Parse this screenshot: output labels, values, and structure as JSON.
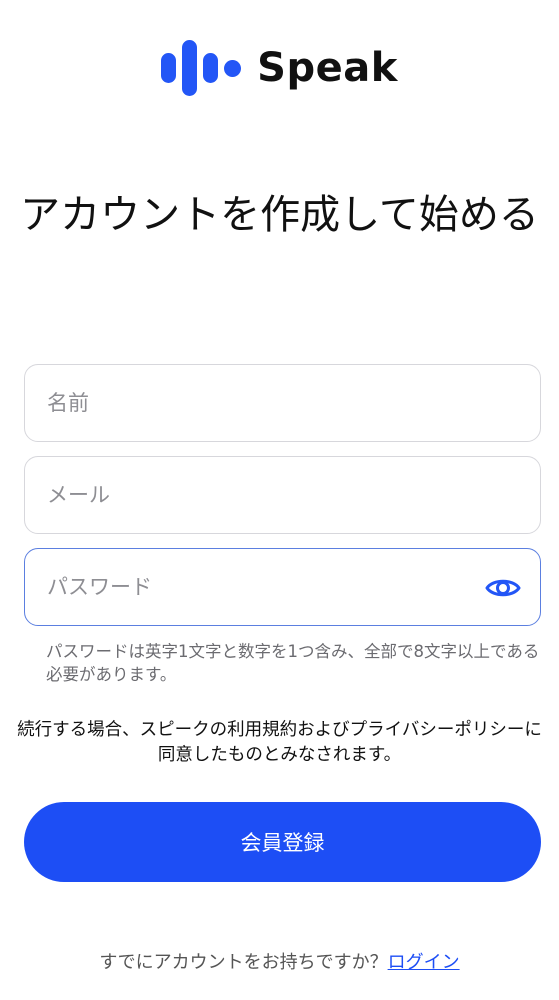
{
  "brand": {
    "name": "Speak",
    "accent_color": "#1d4ef5"
  },
  "title": "アカウントを作成して始める",
  "form": {
    "name_placeholder": "名前",
    "email_placeholder": "メール",
    "password_placeholder": "パスワード",
    "password_toggle_icon": "eye-icon",
    "password_hint": "パスワードは英字1文字と数字を1つ含み、全部で8文字以上である必要があります。"
  },
  "terms_text": "続行する場合、スピークの利用規約およびプライバシーポリシーに同意したものとみなされます。",
  "signup_button": "会員登録",
  "footer": {
    "prompt": "すでにアカウントをお持ちですか？",
    "login_link": "ログイン"
  }
}
